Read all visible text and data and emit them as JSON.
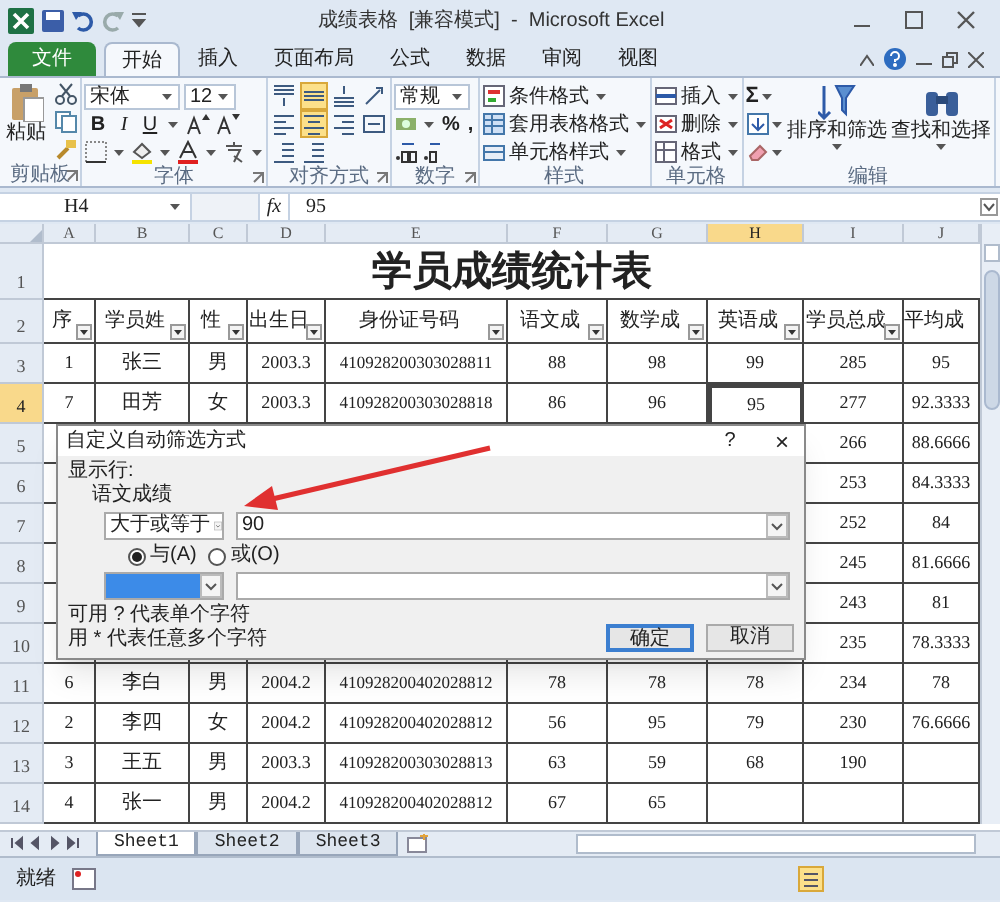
{
  "window": {
    "title": "成绩表格  [兼容模式]  -  Microsoft Excel"
  },
  "ribbon": {
    "tabs": [
      {
        "label": "文件",
        "kind": "file",
        "selected": false
      },
      {
        "label": "开始",
        "kind": "tab",
        "selected": true
      },
      {
        "label": "插入",
        "kind": "tab",
        "selected": false
      },
      {
        "label": "页面布局",
        "kind": "tab",
        "selected": false
      },
      {
        "label": "公式",
        "kind": "tab",
        "selected": false
      },
      {
        "label": "数据",
        "kind": "tab",
        "selected": false
      },
      {
        "label": "审阅",
        "kind": "tab",
        "selected": false
      },
      {
        "label": "视图",
        "kind": "tab",
        "selected": false
      }
    ],
    "groups": [
      {
        "kind": "clipboard",
        "label": "剪贴板",
        "paste_label": "粘贴"
      },
      {
        "kind": "font",
        "label": "字体",
        "font_name": "宋体",
        "font_size": "12",
        "buttons": [
          "B",
          "I",
          "U"
        ]
      },
      {
        "kind": "alignment",
        "label": "对齐方式",
        "buttons": [
          {
            "kind": "top",
            "on": false
          },
          {
            "kind": "middle",
            "on": true
          },
          {
            "kind": "bottom",
            "on": false
          },
          {
            "kind": "orientation",
            "on": false
          },
          {
            "kind": "left",
            "on": false
          },
          {
            "kind": "center",
            "on": true
          },
          {
            "kind": "right",
            "on": false
          },
          {
            "kind": "merge",
            "on": false
          },
          {
            "kind": "outdent",
            "on": false
          },
          {
            "kind": "indent",
            "on": false
          }
        ]
      },
      {
        "kind": "number",
        "label": "数字",
        "format": "常规",
        "symbols": [
          "%",
          ","
        ]
      },
      {
        "kind": "styles",
        "label": "样式",
        "items": [
          "条件格式",
          "套用表格格式",
          "单元格样式"
        ]
      },
      {
        "kind": "cells",
        "label": "单元格",
        "items": [
          "插入",
          "删除",
          "格式"
        ]
      },
      {
        "kind": "editing",
        "label": "编辑",
        "sum": "Σ",
        "items": [
          "排序和筛选",
          "查找和选择"
        ]
      }
    ]
  },
  "formula_bar": {
    "name_box": "H4",
    "function_label": "fx",
    "value": "95"
  },
  "sheet": {
    "columns": [
      {
        "label": "A",
        "selected": false
      },
      {
        "label": "B",
        "selected": false
      },
      {
        "label": "C",
        "selected": false
      },
      {
        "label": "D",
        "selected": false
      },
      {
        "label": "E",
        "selected": false
      },
      {
        "label": "F",
        "selected": false
      },
      {
        "label": "G",
        "selected": false
      },
      {
        "label": "H",
        "selected": true
      },
      {
        "label": "I",
        "selected": false
      },
      {
        "label": "J",
        "selected": false
      }
    ],
    "rows": [
      {
        "number": "1",
        "kind": "title",
        "selected": false,
        "text": "学员成绩统计表"
      },
      {
        "number": "2",
        "kind": "header",
        "selected": false,
        "cells": [
          "序",
          "学员姓",
          "性",
          "出生日",
          "身份证号码",
          "语文成",
          "数学成",
          "英语成",
          "学员总成",
          "平均成"
        ],
        "filters": [
          true,
          true,
          true,
          true,
          true,
          true,
          true,
          true,
          true,
          false
        ]
      },
      {
        "number": "3",
        "kind": "data",
        "selected": false,
        "cells": [
          "1",
          "张三",
          "男",
          "2003.3",
          "410928200303028811",
          "88",
          "98",
          "99",
          "285",
          "95"
        ]
      },
      {
        "number": "4",
        "kind": "data",
        "selected": true,
        "cells": [
          "7",
          "田芳",
          "女",
          "2003.3",
          "410928200303028818",
          "86",
          "96",
          "95",
          "277",
          "92.3333"
        ]
      },
      {
        "number": "5",
        "kind": "data",
        "selected": false,
        "cells": [
          null,
          null,
          null,
          null,
          null,
          null,
          null,
          null,
          "266",
          "88.6666"
        ]
      },
      {
        "number": "6",
        "kind": "data",
        "selected": false,
        "cells": [
          null,
          null,
          null,
          null,
          null,
          null,
          null,
          null,
          "253",
          "84.3333"
        ]
      },
      {
        "number": "7",
        "kind": "data",
        "selected": false,
        "cells": [
          null,
          null,
          null,
          null,
          null,
          null,
          null,
          null,
          "252",
          "84"
        ]
      },
      {
        "number": "8",
        "kind": "data",
        "selected": false,
        "cells": [
          null,
          null,
          null,
          null,
          null,
          null,
          null,
          null,
          "245",
          "81.6666"
        ]
      },
      {
        "number": "9",
        "kind": "data",
        "selected": false,
        "cells": [
          null,
          null,
          null,
          null,
          null,
          null,
          null,
          null,
          "243",
          "81"
        ]
      },
      {
        "number": "10",
        "kind": "data",
        "selected": false,
        "cells": [
          null,
          null,
          null,
          null,
          null,
          null,
          null,
          null,
          "235",
          "78.3333"
        ]
      },
      {
        "number": "11",
        "kind": "data",
        "selected": false,
        "cells": [
          "6",
          "李白",
          "男",
          "2004.2",
          "410928200402028812",
          "78",
          "78",
          "78",
          "234",
          "78"
        ]
      },
      {
        "number": "12",
        "kind": "data",
        "selected": false,
        "cells": [
          "2",
          "李四",
          "女",
          "2004.2",
          "410928200402028812",
          "56",
          "95",
          "79",
          "230",
          "76.6666"
        ]
      },
      {
        "number": "13",
        "kind": "data",
        "selected": false,
        "cells": [
          "3",
          "王五",
          "男",
          "2003.3",
          "410928200303028813",
          "63",
          "59",
          "68",
          "190",
          null
        ]
      },
      {
        "number": "14",
        "kind": "data",
        "selected": false,
        "cells": [
          "4",
          "张一",
          "男",
          "2004.2",
          "410928200402028812",
          "67",
          "65",
          null,
          null,
          null
        ]
      }
    ],
    "tabs": [
      {
        "label": "Sheet1",
        "selected": true
      },
      {
        "label": "Sheet2",
        "selected": false
      },
      {
        "label": "Sheet3",
        "selected": false
      }
    ]
  },
  "status_bar": {
    "text": "就绪"
  },
  "dialog": {
    "title": "自定义自动筛选方式",
    "help": "?",
    "close": "×",
    "section": "显示行:",
    "field": "语文成绩",
    "conditions": [
      {
        "operator": "大于或等于",
        "value": "90",
        "focused": false
      },
      {
        "focused": true
      }
    ],
    "joiners": [
      {
        "label": "与(A)",
        "selected": true
      },
      {
        "label": "或(O)",
        "selected": false
      }
    ],
    "hints": [
      "可用 ? 代表单个字符",
      "用 * 代表任意多个字符"
    ],
    "buttons": [
      {
        "label": "确定",
        "default": true
      },
      {
        "label": "取消",
        "default": false
      }
    ]
  }
}
